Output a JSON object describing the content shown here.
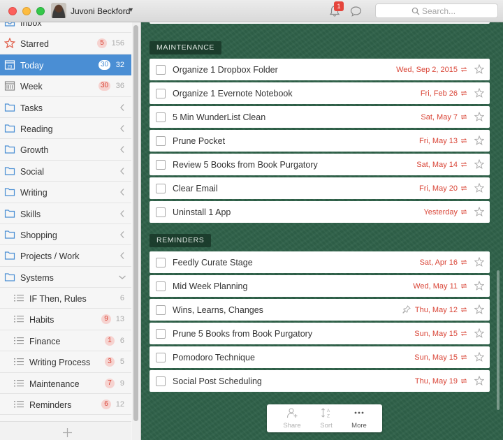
{
  "titlebar": {
    "user_name": "Juvoni Beckford",
    "notification_count": "1",
    "search_placeholder": "Search..."
  },
  "sidebar": {
    "items": [
      {
        "label": "Inbox",
        "icon": "inbox-icon"
      },
      {
        "label": "Starred",
        "icon": "star-icon",
        "badge": "5",
        "count": "156"
      },
      {
        "label": "Today",
        "icon": "calendar-icon",
        "badge": "30",
        "count": "32",
        "active": true
      },
      {
        "label": "Week",
        "icon": "week-calendar-icon",
        "badge": "30",
        "count": "36"
      },
      {
        "label": "Tasks",
        "icon": "folder-icon"
      },
      {
        "label": "Reading",
        "icon": "folder-icon"
      },
      {
        "label": "Growth",
        "icon": "folder-icon"
      },
      {
        "label": "Social",
        "icon": "folder-icon"
      },
      {
        "label": "Writing",
        "icon": "folder-icon"
      },
      {
        "label": "Skills",
        "icon": "folder-icon"
      },
      {
        "label": "Shopping",
        "icon": "folder-icon"
      },
      {
        "label": "Projects / Work",
        "icon": "folder-icon"
      },
      {
        "label": "Systems",
        "icon": "folder-icon",
        "expanded": true
      },
      {
        "label": "IF Then, Rules",
        "icon": "list-icon",
        "count": "6"
      },
      {
        "label": "Habits",
        "icon": "list-icon",
        "badge": "9",
        "count": "13"
      },
      {
        "label": "Finance",
        "icon": "list-icon",
        "badge": "1",
        "count": "6"
      },
      {
        "label": "Writing Process",
        "icon": "list-icon",
        "badge": "3",
        "count": "5"
      },
      {
        "label": "Maintenance",
        "icon": "list-icon",
        "badge": "7",
        "count": "9"
      },
      {
        "label": "Reminders",
        "icon": "list-icon",
        "badge": "6",
        "count": "12"
      }
    ]
  },
  "main": {
    "sections": [
      {
        "label": "MAINTENANCE",
        "tasks": [
          {
            "title": "Organize 1 Dropbox Folder",
            "due": "Wed, Sep 2, 2015"
          },
          {
            "title": "Organize 1 Evernote Notebook",
            "due": "Fri, Feb 26"
          },
          {
            "title": "5 Min WunderList Clean",
            "due": "Sat, May 7"
          },
          {
            "title": "Prune Pocket",
            "due": "Fri, May 13"
          },
          {
            "title": "Review 5 Books from Book Purgatory",
            "due": "Sat, May 14"
          },
          {
            "title": "Clear Email",
            "due": "Fri, May 20"
          },
          {
            "title": "Uninstall 1 App",
            "due": "Yesterday"
          }
        ]
      },
      {
        "label": "REMINDERS",
        "tasks": [
          {
            "title": "Feedly Curate Stage",
            "due": "Sat, Apr 16"
          },
          {
            "title": "Mid Week Planning",
            "due": "Wed, May 11"
          },
          {
            "title": "Wins, Learns, Changes",
            "due": "Thu, May 12",
            "pinned": true
          },
          {
            "title": "Prune 5 Books from Book Purgatory",
            "due": "Sun, May 15"
          },
          {
            "title": "Pomodoro Technique",
            "due": "Sun, May 15"
          },
          {
            "title": "Social Post Scheduling",
            "due": "Thu, May 19"
          }
        ]
      }
    ]
  },
  "toolbar": {
    "share_label": "Share",
    "sort_label": "Sort",
    "more_label": "More"
  },
  "colors": {
    "accent": "#4a8ed4",
    "due_red": "#d94436",
    "background_green": "#2f6149"
  }
}
